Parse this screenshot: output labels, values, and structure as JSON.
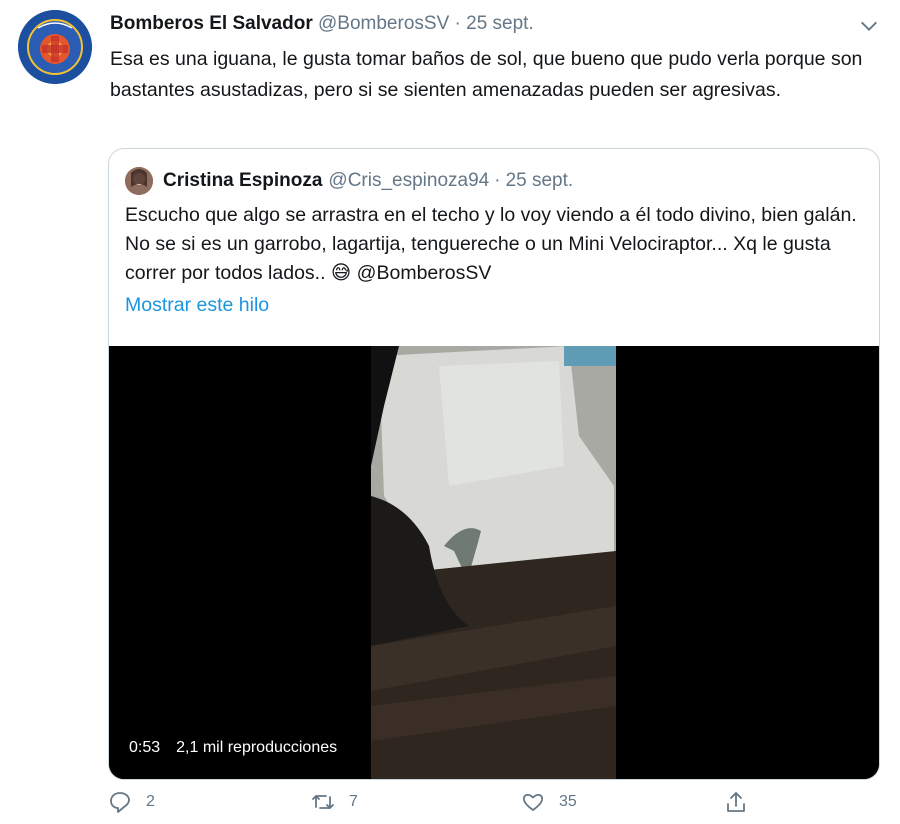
{
  "tweet": {
    "author_name": "Bomberos El Salvador",
    "author_handle": "@BomberosSV",
    "separator": "·",
    "date": "25 sept.",
    "text": "Esa es una iguana, le gusta tomar baños de sol, que bueno que pudo verla porque son bastantes asustadizas, pero si se sienten amenazadas pueden ser agresivas.",
    "avatar_icon": "fire-department-logo-icon",
    "menu_icon": "chevron-down-icon"
  },
  "quote": {
    "author_name": "Cristina Espinoza",
    "author_handle": "@Cris_espinoza94",
    "separator": "·",
    "date": "25 sept.",
    "text": "Escucho que algo se arrastra en el techo y lo voy viendo a él todo divino, bien galán. No se si es un garrobo, lagartija, tenguereche o un Mini Velociraptor... Xq le gusta correr por todos lados.. 😅 @BomberosSV",
    "show_thread_label": "Mostrar este hilo",
    "video": {
      "duration": "0:53",
      "views": "2,1 mil reproducciones"
    }
  },
  "actions": {
    "reply_count": "2",
    "retweet_count": "7",
    "like_count": "35",
    "icons": [
      "reply-icon",
      "retweet-icon",
      "like-icon",
      "share-icon"
    ]
  },
  "colors": {
    "text": "#14171a",
    "secondary": "#657786",
    "link": "#1b95e0",
    "border": "#ccd6dd"
  }
}
